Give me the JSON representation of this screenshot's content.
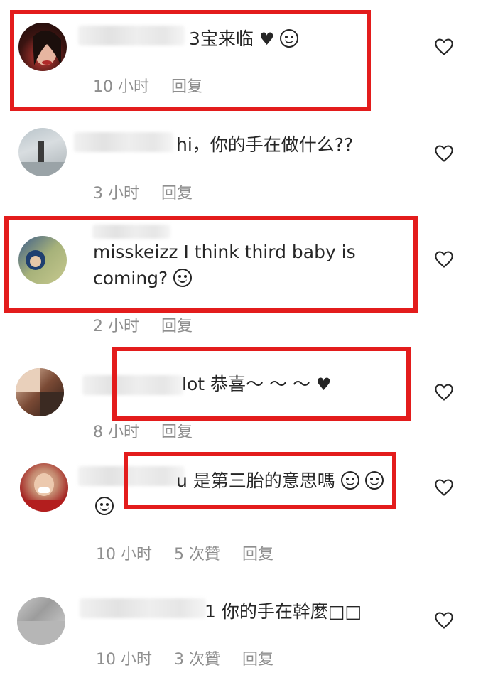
{
  "comments": [
    {
      "id": "c1",
      "text": "3宝来临",
      "time": "10 小时",
      "likes": "",
      "reply": "回复"
    },
    {
      "id": "c2",
      "text": "hi，你的手在做什么??",
      "time": "3 小时",
      "likes": "",
      "reply": "回复"
    },
    {
      "id": "c3",
      "text_line1": "misskeizz I think third baby is",
      "text_line2": "coming?",
      "time": "2 小时",
      "likes": "",
      "reply": "回复"
    },
    {
      "id": "c4",
      "text": "lot 恭喜～ ～ ～",
      "time": "8 小时",
      "likes": "",
      "reply": "回复"
    },
    {
      "id": "c5",
      "text": "u 是第三胎的意思嗎",
      "time": "10 小时",
      "likes": "5 次贊",
      "reply": "回复"
    },
    {
      "id": "c6",
      "text": "1 你的手在幹麼□□",
      "time": "10 小时",
      "likes": "3 次贊",
      "reply": "回复"
    }
  ],
  "colors": {
    "highlight_box": "#e31c1c",
    "text": "#262626",
    "meta": "#8e8e8e"
  }
}
